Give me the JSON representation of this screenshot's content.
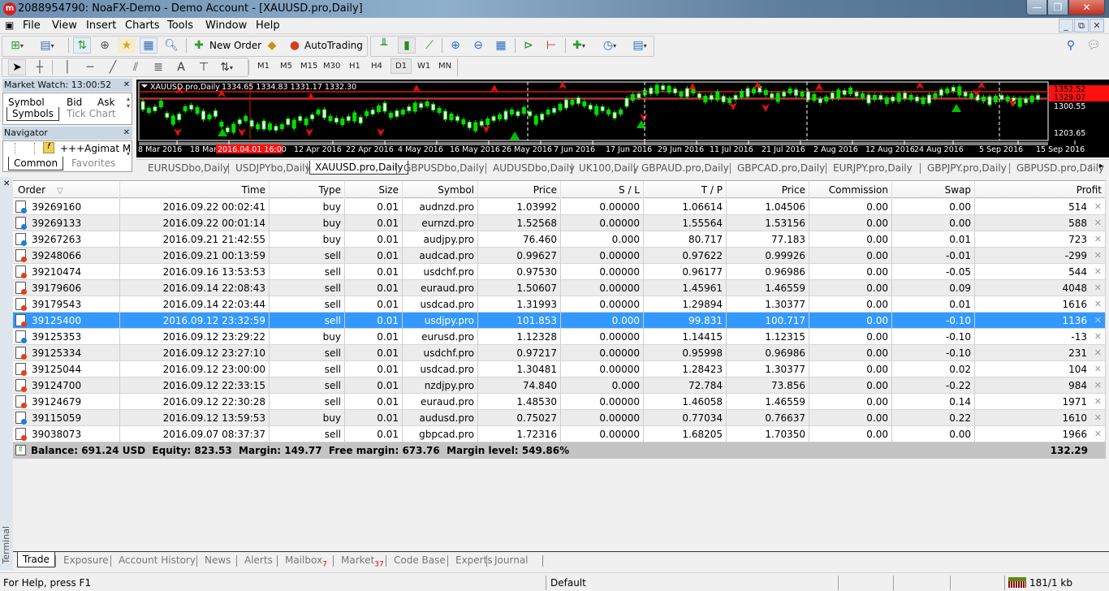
{
  "window": {
    "title": "2088954790: NoaFX-Demo - Demo Account - [XAUUSD.pro,Daily]",
    "controls": {
      "minimize": "—",
      "maximize": "❐",
      "close": "✕"
    }
  },
  "menu": [
    "File",
    "View",
    "Insert",
    "Charts",
    "Tools",
    "Window",
    "Help"
  ],
  "mdi_controls": {
    "minimize": "_",
    "restore": "🗗",
    "close": "✕"
  },
  "toolbar": {
    "new_order_label": "New Order",
    "autotrading_label": "AutoTrading",
    "icons": [
      "new-chart-icon",
      "profiles-icon",
      "market-watch-icon",
      "crosshair-data-icon",
      "navigator-icon",
      "terminal-icon",
      "strategy-tester-icon",
      "new-order-icon",
      "metaeditor-icon",
      "autotrading-icon",
      "bar-chart-icon",
      "candlesticks-icon",
      "line-chart-icon",
      "zoom-in-icon",
      "zoom-out-icon",
      "tile-windows-icon",
      "autoscroll-icon",
      "chart-shift-icon",
      "indicators-icon",
      "periods-icon",
      "templates-icon",
      "search-icon",
      "chat-icon"
    ]
  },
  "drawing_toolbar": {
    "tools": [
      "cursor-icon",
      "crosshair-icon",
      "vertical-line-icon",
      "horizontal-line-icon",
      "trendline-icon",
      "equidistant-channel-icon",
      "fibonacci-icon",
      "text-icon",
      "text-label-icon",
      "arrows-icon"
    ],
    "text_tool_label": "A",
    "timeframes": [
      "M1",
      "M5",
      "M15",
      "M30",
      "H1",
      "H4",
      "D1",
      "W1",
      "MN"
    ],
    "active_timeframe": "D1"
  },
  "market_watch": {
    "title": "Market Watch: 13:00:52",
    "columns": [
      "Symbol",
      "Bid",
      "Ask"
    ],
    "tabs": [
      "Symbols",
      "Tick Chart"
    ],
    "active_tab": "Symbols"
  },
  "navigator": {
    "title": "Navigator",
    "item": "+++Agimat M",
    "tabs": [
      "Common",
      "Favorites"
    ],
    "active_tab": "Common"
  },
  "chart": {
    "header": "XAUUSD.pro,Daily",
    "ohlc": "1334.65 1334.83 1331.17 1332.30",
    "price_labels": {
      "high_line": "1352.52",
      "current": "1329.07",
      "mid": "1300.55",
      "low": "1203.65"
    },
    "crosshair_time": "2016.04.01 16:00",
    "date_labels": [
      "8 Mar 2016",
      "18 Mar 2016",
      "12 Apr 2016",
      "22 Apr 2016",
      "4 May 2016",
      "16 May 2016",
      "26 May 2016",
      "7 Jun 2016",
      "17 Jun 2016",
      "29 Jun 2016",
      "11 Jul 2016",
      "21 Jul 2016",
      "2 Aug 2016",
      "12 Aug 2016",
      "24 Aug 2016",
      "5 Sep 2016",
      "15 Sep 2016"
    ],
    "colors": {
      "background": "#000000",
      "bull": "#00e000",
      "level": "#e01010",
      "arrows": "#e01010"
    }
  },
  "chart_tabs": [
    "EURUSDbo,Daily",
    "USDJPYbo,Daily",
    "XAUUSD.pro,Daily",
    "GBPUSDbo,Daily",
    "AUDUSDbo,Daily",
    "UK100,Daily",
    "GBPAUD.pro,Daily",
    "GBPCAD.pro,Daily",
    "EURJPY.pro,Daily",
    "GBPJPY.pro,Daily",
    "GBPUSD.pro,Daily"
  ],
  "active_chart_tab": "XAUUSD.pro,Daily",
  "terminal": {
    "label": "Terminal",
    "columns": [
      "Order",
      "Time",
      "Type",
      "Size",
      "Symbol",
      "Price",
      "S / L",
      "T / P",
      "Price",
      "Commission",
      "Swap",
      "Profit"
    ],
    "sort_indicator": "▽",
    "orders": [
      {
        "order": "39269160",
        "time": "2016.09.22 00:02:41",
        "type": "buy",
        "size": "0.01",
        "symbol": "audnzd.pro",
        "price": "1.03992",
        "sl": "0.00000",
        "tp": "1.06614",
        "cur": "1.04506",
        "commission": "0.00",
        "swap": "0.00",
        "profit": "514"
      },
      {
        "order": "39269133",
        "time": "2016.09.22 00:01:14",
        "type": "buy",
        "size": "0.01",
        "symbol": "eurnzd.pro",
        "price": "1.52568",
        "sl": "0.00000",
        "tp": "1.55564",
        "cur": "1.53156",
        "commission": "0.00",
        "swap": "0.00",
        "profit": "588"
      },
      {
        "order": "39267263",
        "time": "2016.09.21 21:42:55",
        "type": "buy",
        "size": "0.01",
        "symbol": "audjpy.pro",
        "price": "76.460",
        "sl": "0.000",
        "tp": "80.717",
        "cur": "77.183",
        "commission": "0.00",
        "swap": "0.01",
        "profit": "723"
      },
      {
        "order": "39248066",
        "time": "2016.09.21 00:13:59",
        "type": "sell",
        "size": "0.01",
        "symbol": "audcad.pro",
        "price": "0.99627",
        "sl": "0.00000",
        "tp": "0.97622",
        "cur": "0.99926",
        "commission": "0.00",
        "swap": "-0.01",
        "profit": "-299"
      },
      {
        "order": "39210474",
        "time": "2016.09.16 13:53:53",
        "type": "sell",
        "size": "0.01",
        "symbol": "usdchf.pro",
        "price": "0.97530",
        "sl": "0.00000",
        "tp": "0.96177",
        "cur": "0.96986",
        "commission": "0.00",
        "swap": "-0.05",
        "profit": "544"
      },
      {
        "order": "39179606",
        "time": "2016.09.14 22:08:43",
        "type": "sell",
        "size": "0.01",
        "symbol": "euraud.pro",
        "price": "1.50607",
        "sl": "0.00000",
        "tp": "1.45961",
        "cur": "1.46559",
        "commission": "0.00",
        "swap": "0.09",
        "profit": "4048"
      },
      {
        "order": "39179543",
        "time": "2016.09.14 22:03:44",
        "type": "sell",
        "size": "0.01",
        "symbol": "usdcad.pro",
        "price": "1.31993",
        "sl": "0.00000",
        "tp": "1.29894",
        "cur": "1.30377",
        "commission": "0.00",
        "swap": "0.01",
        "profit": "1616"
      },
      {
        "order": "39125400",
        "time": "2016.09.12 23:32:59",
        "type": "sell",
        "size": "0.01",
        "symbol": "usdjpy.pro",
        "price": "101.853",
        "sl": "0.000",
        "tp": "99.831",
        "cur": "100.717",
        "commission": "0.00",
        "swap": "-0.10",
        "profit": "1136"
      },
      {
        "order": "39125353",
        "time": "2016.09.12 23:29:22",
        "type": "buy",
        "size": "0.01",
        "symbol": "eurusd.pro",
        "price": "1.12328",
        "sl": "0.00000",
        "tp": "1.14415",
        "cur": "1.12315",
        "commission": "0.00",
        "swap": "-0.10",
        "profit": "-13"
      },
      {
        "order": "39125334",
        "time": "2016.09.12 23:27:10",
        "type": "sell",
        "size": "0.01",
        "symbol": "usdchf.pro",
        "price": "0.97217",
        "sl": "0.00000",
        "tp": "0.95998",
        "cur": "0.96986",
        "commission": "0.00",
        "swap": "-0.10",
        "profit": "231"
      },
      {
        "order": "39125044",
        "time": "2016.09.12 23:00:00",
        "type": "sell",
        "size": "0.01",
        "symbol": "usdcad.pro",
        "price": "1.30481",
        "sl": "0.00000",
        "tp": "1.28423",
        "cur": "1.30377",
        "commission": "0.00",
        "swap": "0.02",
        "profit": "104"
      },
      {
        "order": "39124700",
        "time": "2016.09.12 22:33:15",
        "type": "sell",
        "size": "0.01",
        "symbol": "nzdjpy.pro",
        "price": "74.840",
        "sl": "0.000",
        "tp": "72.784",
        "cur": "73.856",
        "commission": "0.00",
        "swap": "-0.22",
        "profit": "984"
      },
      {
        "order": "39124679",
        "time": "2016.09.12 22:30:28",
        "type": "sell",
        "size": "0.01",
        "symbol": "euraud.pro",
        "price": "1.48530",
        "sl": "0.00000",
        "tp": "1.46058",
        "cur": "1.46559",
        "commission": "0.00",
        "swap": "0.14",
        "profit": "1971"
      },
      {
        "order": "39115059",
        "time": "2016.09.12 13:59:53",
        "type": "buy",
        "size": "0.01",
        "symbol": "audusd.pro",
        "price": "0.75027",
        "sl": "0.00000",
        "tp": "0.77034",
        "cur": "0.76637",
        "commission": "0.00",
        "swap": "0.22",
        "profit": "1610"
      },
      {
        "order": "39038073",
        "time": "2016.09.07 08:37:37",
        "type": "sell",
        "size": "0.01",
        "symbol": "gbpcad.pro",
        "price": "1.72316",
        "sl": "0.00000",
        "tp": "1.68205",
        "cur": "1.70350",
        "commission": "0.00",
        "swap": "0.00",
        "profit": "1966"
      }
    ],
    "selected_order": "39125400",
    "summary": "Balance: 691.24 USD  Equity: 823.53  Margin: 149.77  Free margin: 673.76  Margin level: 549.86%",
    "total_profit": "132.29",
    "tabs": [
      {
        "label": "Trade",
        "badge": ""
      },
      {
        "label": "Exposure",
        "badge": ""
      },
      {
        "label": "Account History",
        "badge": ""
      },
      {
        "label": "News",
        "badge": ""
      },
      {
        "label": "Alerts",
        "badge": ""
      },
      {
        "label": "Mailbox",
        "badge": "7"
      },
      {
        "label": "Market",
        "badge": "37"
      },
      {
        "label": "Code Base",
        "badge": ""
      },
      {
        "label": "Experts",
        "badge": ""
      },
      {
        "label": "Journal",
        "badge": ""
      }
    ],
    "active_tab": "Trade"
  },
  "status": {
    "help": "For Help, press F1",
    "profile": "Default",
    "connection": "181/1 kb"
  }
}
